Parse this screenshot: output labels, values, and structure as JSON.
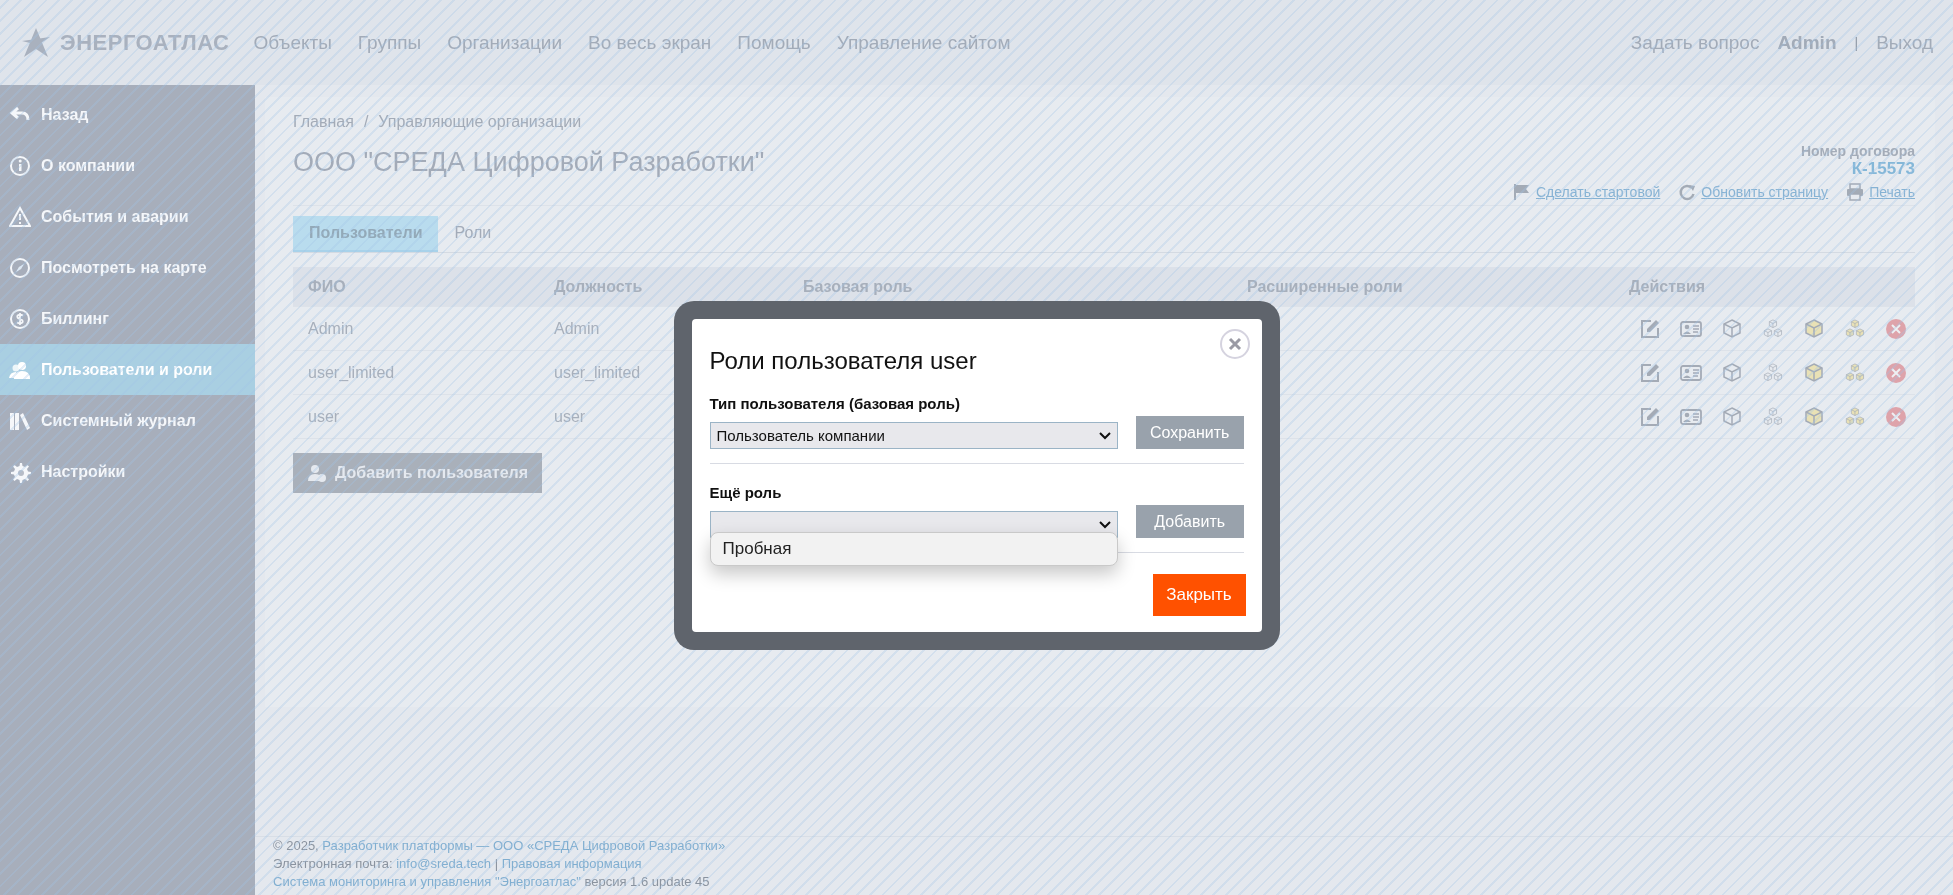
{
  "header": {
    "logo_text": "ЭНЕРГОАТЛАС",
    "nav": [
      "Объекты",
      "Группы",
      "Организации",
      "Во весь экран",
      "Помощь",
      "Управление сайтом"
    ],
    "ask": "Задать вопрос",
    "user": "Admin",
    "separator": "|",
    "logout": "Выход"
  },
  "sidebar": {
    "items": [
      {
        "label": "Назад",
        "selected": false
      },
      {
        "label": "О компании",
        "selected": false
      },
      {
        "label": "События и аварии",
        "selected": false
      },
      {
        "label": "Посмотреть на карте",
        "selected": false
      },
      {
        "label": "Биллинг",
        "selected": false
      },
      {
        "label": "Пользователи и роли",
        "selected": true
      },
      {
        "label": "Системный журнал",
        "selected": false
      },
      {
        "label": "Настройки",
        "selected": false
      }
    ]
  },
  "breadcrumb": {
    "items": [
      "Главная",
      "Управляющие организации"
    ],
    "separator": "/"
  },
  "title": "ООО \"СРЕДА Цифровой Разработки\"",
  "contract": {
    "label": "Номер договора",
    "value": "К-15573"
  },
  "toolbar": [
    "Сделать стартовой",
    "Обновить страницу",
    "Печать"
  ],
  "tabs": [
    {
      "label": "Пользователи",
      "selected": true
    },
    {
      "label": "Роли",
      "selected": false
    }
  ],
  "table": {
    "columns": [
      "ФИО",
      "Должность",
      "Базовая роль",
      "Расширенные роли",
      "Действия"
    ],
    "rows": [
      {
        "fio": "Admin",
        "position": "Admin"
      },
      {
        "fio": "user_limited",
        "position": "user_limited"
      },
      {
        "fio": "user",
        "position": "user"
      }
    ]
  },
  "add_user_button": "Добавить пользователя",
  "dialog": {
    "title": "Роли пользователя user",
    "base_role_label": "Тип пользователя (базовая роль)",
    "base_role_value": "Пользователь компании",
    "save_button": "Сохранить",
    "extra_role_label": "Ещё роль",
    "add_button": "Добавить",
    "dropdown_options": [
      "Пробная"
    ],
    "close_button": "Закрыть"
  },
  "footer": {
    "lines": [
      [
        {
          "text": "© 2025, ",
          "link": false
        },
        {
          "text": "Разработчик платформы — ООО «СРЕДА Цифровой Разработки»",
          "link": true
        }
      ],
      [
        {
          "text": "Электронная почта: ",
          "link": false
        },
        {
          "text": "info@sreda.tech",
          "link": true
        },
        {
          "text": " | ",
          "link": false
        },
        {
          "text": "Правовая информация",
          "link": true
        }
      ],
      [
        {
          "text": "Система мониторинга и управления \"Энергоатлас\"",
          "link": true
        },
        {
          "text": " версия 1.6 update 45",
          "link": false
        }
      ]
    ]
  }
}
